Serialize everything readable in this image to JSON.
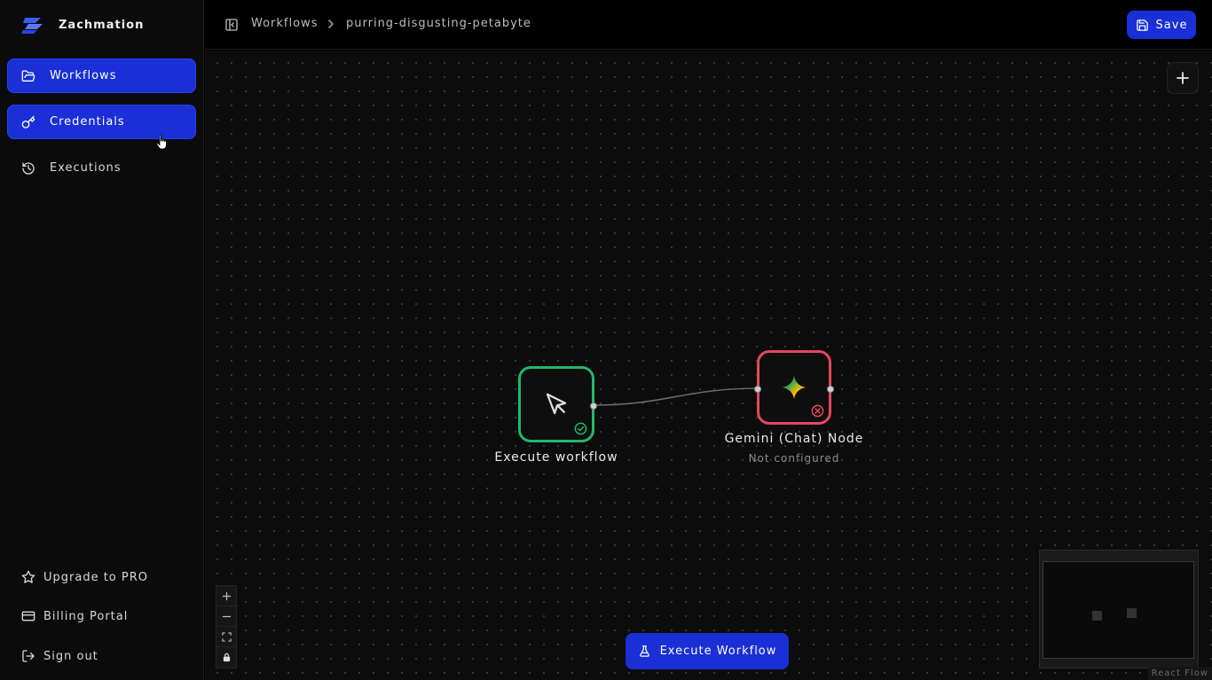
{
  "app": {
    "name": "Zachmation"
  },
  "sidebar": {
    "items": [
      {
        "label": "Workflows",
        "icon": "folder-open-icon",
        "active": true
      },
      {
        "label": "Credentials",
        "icon": "key-icon",
        "active": true
      },
      {
        "label": "Executions",
        "icon": "history-icon",
        "active": false
      }
    ],
    "bottom": [
      {
        "label": "Upgrade to PRO",
        "icon": "star-icon"
      },
      {
        "label": "Billing Portal",
        "icon": "credit-card-icon"
      },
      {
        "label": "Sign out",
        "icon": "log-out-icon"
      }
    ]
  },
  "header": {
    "breadcrumb": {
      "root": "Workflows",
      "current": "purring-disgusting-petabyte"
    },
    "save_label": "Save"
  },
  "canvas": {
    "nodes": [
      {
        "label": "Execute workflow",
        "status": "success",
        "icon": "mouse-pointer-icon"
      },
      {
        "label": "Gemini (Chat) Node",
        "subtitle": "Not configured",
        "status": "error",
        "icon": "gemini-sparkle-icon"
      }
    ],
    "execute_label": "Execute Workflow",
    "attribution": "React Flow"
  },
  "colors": {
    "accent": "#1a2fd6",
    "success": "#22b86a",
    "error": "#e5485d"
  }
}
